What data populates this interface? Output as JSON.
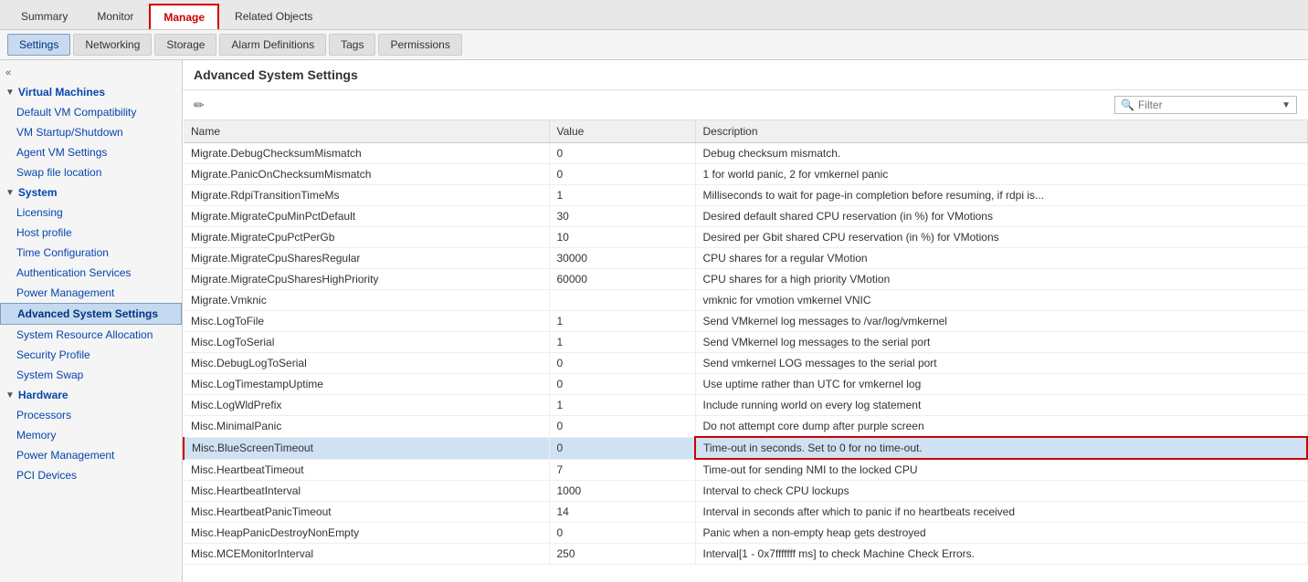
{
  "topTabs": [
    {
      "id": "summary",
      "label": "Summary",
      "active": false
    },
    {
      "id": "monitor",
      "label": "Monitor",
      "active": false
    },
    {
      "id": "manage",
      "label": "Manage",
      "active": true
    },
    {
      "id": "related-objects",
      "label": "Related Objects",
      "active": false
    }
  ],
  "secondTabs": [
    {
      "id": "settings",
      "label": "Settings",
      "active": true
    },
    {
      "id": "networking",
      "label": "Networking",
      "active": false
    },
    {
      "id": "storage",
      "label": "Storage",
      "active": false
    },
    {
      "id": "alarm-definitions",
      "label": "Alarm Definitions",
      "active": false
    },
    {
      "id": "tags",
      "label": "Tags",
      "active": false
    },
    {
      "id": "permissions",
      "label": "Permissions",
      "active": false
    }
  ],
  "sidebar": {
    "collapseLabel": "«",
    "sections": [
      {
        "id": "virtual-machines",
        "label": "Virtual Machines",
        "expanded": true,
        "items": [
          {
            "id": "default-vm-compatibility",
            "label": "Default VM Compatibility"
          },
          {
            "id": "vm-startup-shutdown",
            "label": "VM Startup/Shutdown"
          },
          {
            "id": "agent-vm-settings",
            "label": "Agent VM Settings"
          },
          {
            "id": "swap-file-location",
            "label": "Swap file location"
          }
        ]
      },
      {
        "id": "system",
        "label": "System",
        "expanded": true,
        "items": [
          {
            "id": "licensing",
            "label": "Licensing"
          },
          {
            "id": "host-profile",
            "label": "Host profile"
          },
          {
            "id": "time-configuration",
            "label": "Time Configuration"
          },
          {
            "id": "authentication-services",
            "label": "Authentication Services"
          },
          {
            "id": "power-management",
            "label": "Power Management"
          },
          {
            "id": "advanced-system-settings",
            "label": "Advanced System Settings",
            "active": true
          },
          {
            "id": "system-resource-allocation",
            "label": "System Resource Allocation"
          },
          {
            "id": "security-profile",
            "label": "Security Profile"
          },
          {
            "id": "system-swap",
            "label": "System Swap"
          }
        ]
      },
      {
        "id": "hardware",
        "label": "Hardware",
        "expanded": true,
        "items": [
          {
            "id": "processors",
            "label": "Processors"
          },
          {
            "id": "memory",
            "label": "Memory"
          },
          {
            "id": "power-management-hw",
            "label": "Power Management"
          },
          {
            "id": "pci-devices",
            "label": "PCI Devices"
          }
        ]
      }
    ]
  },
  "contentHeader": "Advanced System Settings",
  "toolbar": {
    "editIconLabel": "✏",
    "filterPlaceholder": "Filter"
  },
  "tableHeaders": [
    "Name",
    "Value",
    "Description"
  ],
  "tableRows": [
    {
      "name": "Migrate.DebugChecksumMismatch",
      "value": "0",
      "description": "Debug checksum mismatch.",
      "highlighted": false
    },
    {
      "name": "Migrate.PanicOnChecksumMismatch",
      "value": "0",
      "description": "1 for world panic, 2 for vmkernel panic",
      "highlighted": false
    },
    {
      "name": "Migrate.RdpiTransitionTimeMs",
      "value": "1",
      "description": "Milliseconds to wait for page-in completion before resuming, if rdpi is...",
      "highlighted": false
    },
    {
      "name": "Migrate.MigrateCpuMinPctDefault",
      "value": "30",
      "description": "Desired default shared CPU reservation (in %) for VMotions",
      "highlighted": false
    },
    {
      "name": "Migrate.MigrateCpuPctPerGb",
      "value": "10",
      "description": "Desired per Gbit shared CPU reservation (in %) for VMotions",
      "highlighted": false
    },
    {
      "name": "Migrate.MigrateCpuSharesRegular",
      "value": "30000",
      "description": "CPU shares for a regular VMotion",
      "highlighted": false
    },
    {
      "name": "Migrate.MigrateCpuSharesHighPriority",
      "value": "60000",
      "description": "CPU shares for a high priority VMotion",
      "highlighted": false
    },
    {
      "name": "Migrate.Vmknic",
      "value": "",
      "description": "vmknic for vmotion vmkernel VNIC",
      "highlighted": false
    },
    {
      "name": "Misc.LogToFile",
      "value": "1",
      "description": "Send VMkernel log messages to /var/log/vmkernel",
      "highlighted": false
    },
    {
      "name": "Misc.LogToSerial",
      "value": "1",
      "description": "Send VMkernel log messages to the serial port",
      "highlighted": false
    },
    {
      "name": "Misc.DebugLogToSerial",
      "value": "0",
      "description": "Send vmkernel LOG messages to the serial port",
      "highlighted": false
    },
    {
      "name": "Misc.LogTimestampUptime",
      "value": "0",
      "description": "Use uptime rather than UTC for vmkernel log",
      "highlighted": false
    },
    {
      "name": "Misc.LogWldPrefix",
      "value": "1",
      "description": "Include running world on every log statement",
      "highlighted": false
    },
    {
      "name": "Misc.MinimalPanic",
      "value": "0",
      "description": "Do not attempt core dump after purple screen",
      "highlighted": false
    },
    {
      "name": "Misc.BlueScreenTimeout",
      "value": "0",
      "description": "Time-out in seconds. Set to 0 for no time-out.",
      "highlighted": true
    },
    {
      "name": "Misc.HeartbeatTimeout",
      "value": "7",
      "description": "Time-out for sending NMI to the locked CPU",
      "highlighted": false
    },
    {
      "name": "Misc.HeartbeatInterval",
      "value": "1000",
      "description": "Interval to check CPU lockups",
      "highlighted": false
    },
    {
      "name": "Misc.HeartbeatPanicTimeout",
      "value": "14",
      "description": "Interval in seconds after which to panic if no heartbeats received",
      "highlighted": false
    },
    {
      "name": "Misc.HeapPanicDestroyNonEmpty",
      "value": "0",
      "description": "Panic when a non-empty heap gets destroyed",
      "highlighted": false
    },
    {
      "name": "Misc.MCEMonitorInterval",
      "value": "250",
      "description": "Interval[1 - 0x7fffffff ms] to check Machine Check Errors.",
      "highlighted": false
    }
  ]
}
